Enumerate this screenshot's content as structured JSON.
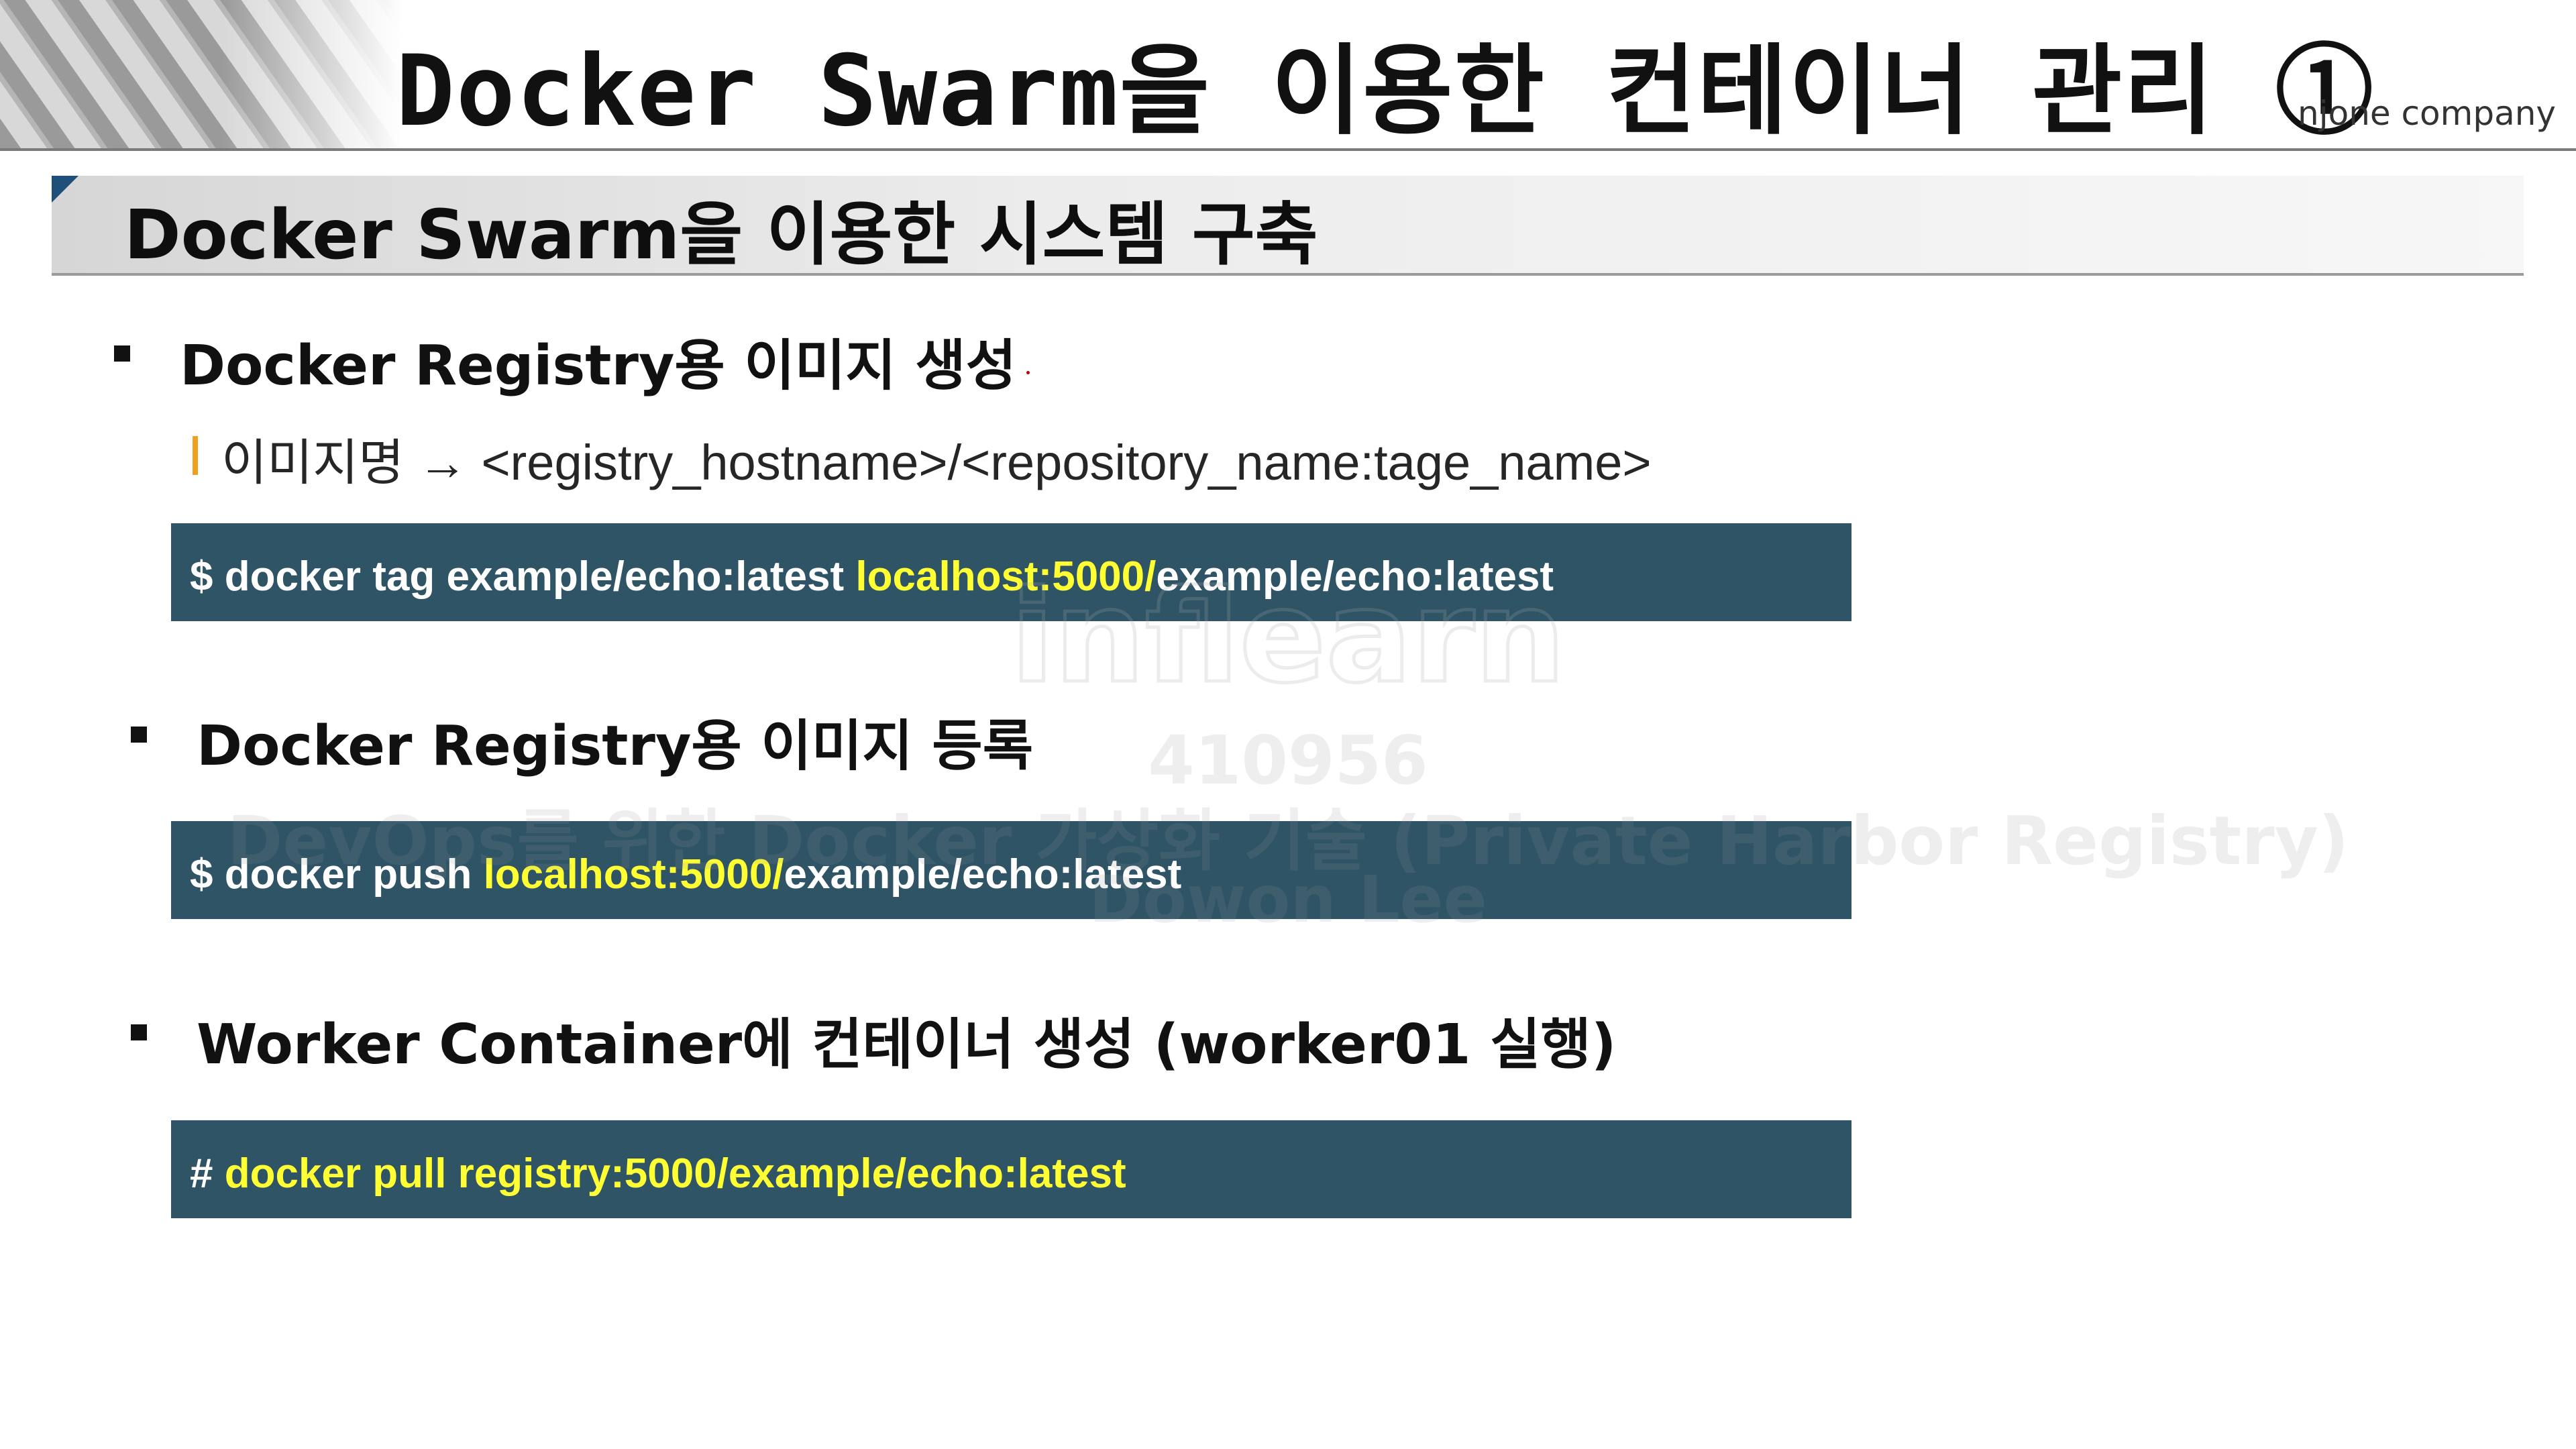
{
  "header": {
    "title": "Docker Swarm을 이용한 컨테이너 관리 ①",
    "company": "njone company"
  },
  "section": {
    "title": "Docker Swarm을 이용한 시스템 구축"
  },
  "bullets": [
    {
      "label": "Docker Registry용 이미지 생성",
      "sub": "이미지명 → <registry_hostname>/<repository_name:tage_name>",
      "code_prefix": "$ docker tag example/echo:latest ",
      "code_highlight": "localhost:5000/",
      "code_suffix": "example/echo:latest"
    },
    {
      "label": "Docker Registry용 이미지 등록",
      "code_prefix": "$ docker push ",
      "code_highlight": "localhost:5000/",
      "code_suffix": "example/echo:latest"
    },
    {
      "label": "Worker Container에 컨테이너 생성 (worker01 실행)",
      "code_prefix": "# ",
      "code_highlight": "docker pull registry:5000/example/echo:latest",
      "code_suffix": ""
    }
  ],
  "watermark": {
    "brand": "inflearn",
    "id": "410956",
    "course": "DevOps를 위한 Docker 가상화 기술 (Private Harbor Registry)",
    "author": "Dowon Lee"
  },
  "colors": {
    "code_background": "#2e5466",
    "code_highlight": "#ffff33",
    "sub_bar": "#f0a020",
    "section_corner": "#1f4e79"
  }
}
